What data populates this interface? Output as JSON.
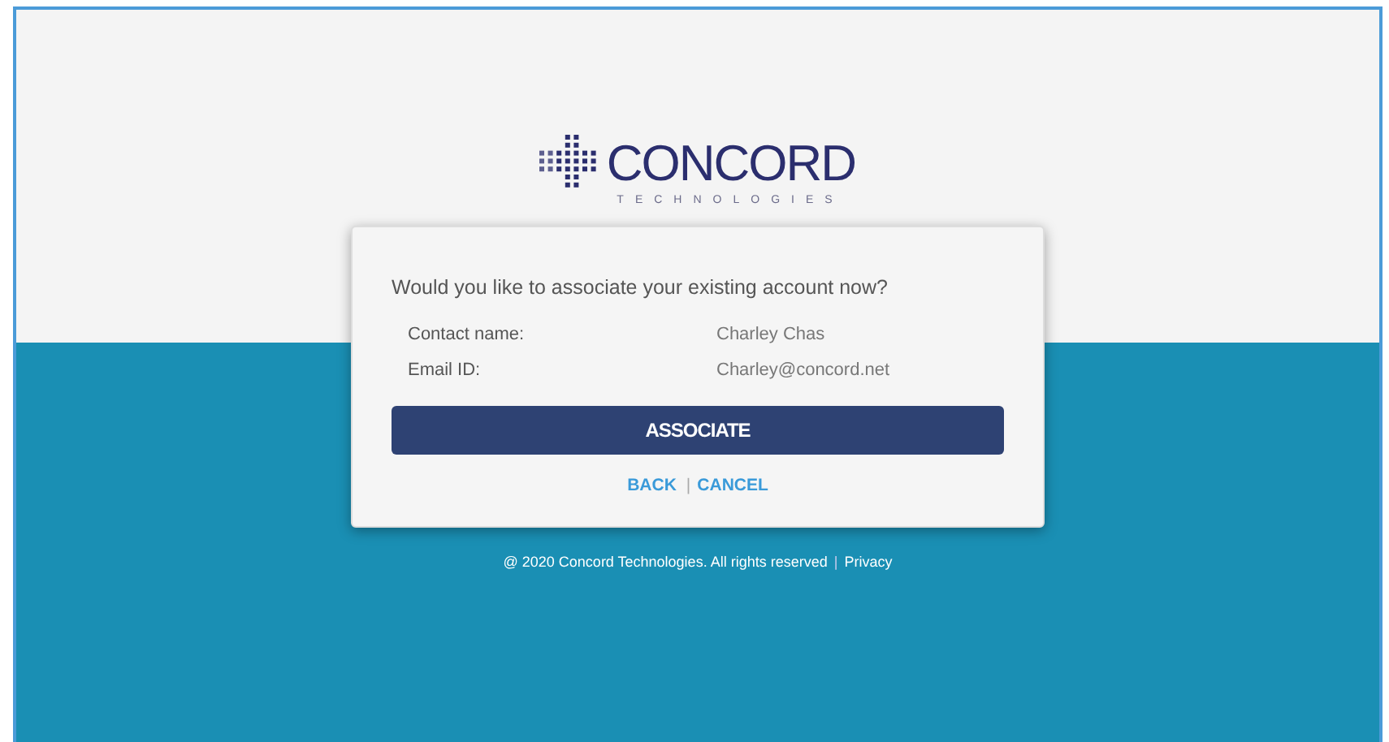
{
  "logo": {
    "name": "CONCORD",
    "tagline": "TECHNOLOGIES"
  },
  "dialog": {
    "question": "Would you like to associate your existing account now?",
    "fields": [
      {
        "label": "Contact name:",
        "value": "Charley Chas"
      },
      {
        "label": "Email ID:",
        "value": "Charley@concord.net"
      }
    ],
    "primary_button": "ASSOCIATE",
    "links": [
      "BACK",
      "CANCEL"
    ],
    "link_separator": "|"
  },
  "footer": {
    "copyright": "@ 2020 Concord Technologies. All rights reserved",
    "separator": "|",
    "link": "Privacy"
  }
}
